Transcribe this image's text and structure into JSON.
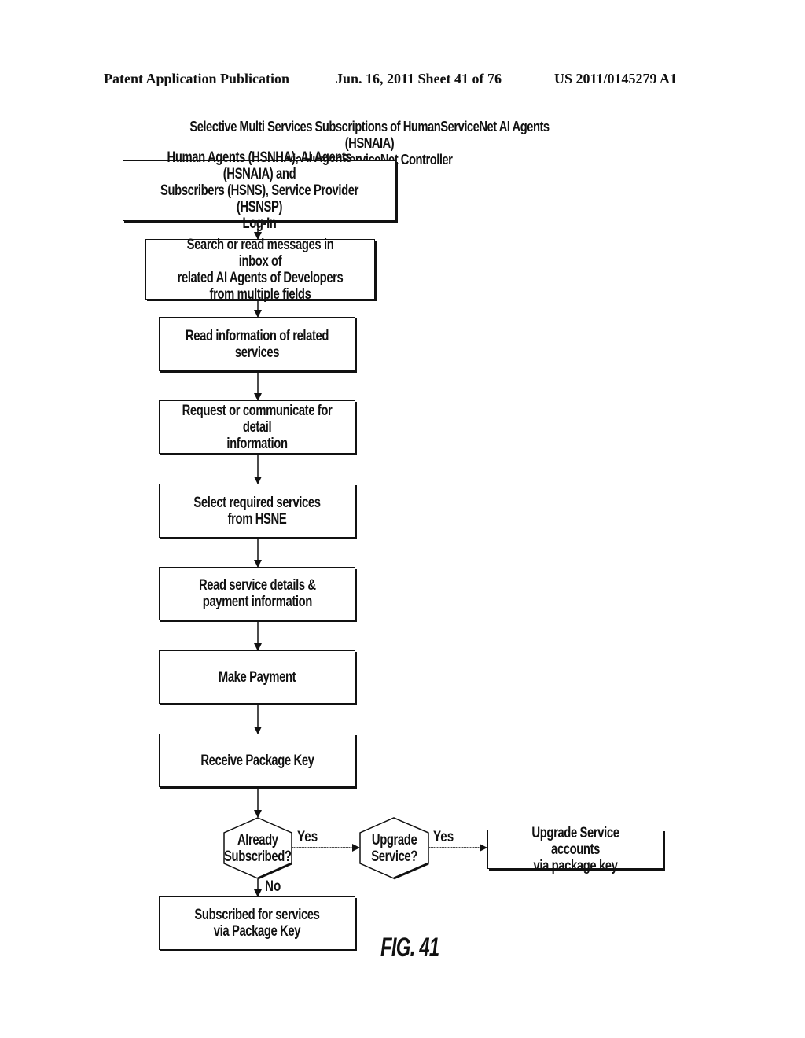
{
  "header": {
    "publication": "Patent Application Publication",
    "date_sheet": "Jun. 16, 2011  Sheet 41 of 76",
    "patent_number": "US 2011/0145279 A1"
  },
  "diagram": {
    "title": "Selective Multi Services Subscriptions of HumanServiceNet AI Agents (HSNAIA)\nvia HumanServiceNet Controller",
    "steps": [
      {
        "id": "login",
        "text": "Human Agents (HSNHA), AI Agents (HSNAIA) and\nSubscribers (HSNS), Service Provider (HSNSP)\nLog-In"
      },
      {
        "id": "search",
        "text": "Search or read messages in inbox of\nrelated AI Agents of Developers\nfrom multiple fields"
      },
      {
        "id": "read-info",
        "text": "Read information of related services"
      },
      {
        "id": "request",
        "text": "Request or communicate for detail\ninformation"
      },
      {
        "id": "select",
        "text": "Select required services from HSNE"
      },
      {
        "id": "read-details",
        "text": "Read service details &\npayment information"
      },
      {
        "id": "payment",
        "text": "Make Payment"
      },
      {
        "id": "receive-key",
        "text": "Receive Package Key"
      },
      {
        "id": "subscribed",
        "text": "Subscribed for services\nvia Package Key"
      },
      {
        "id": "upgrade-accounts",
        "text": "Upgrade Service accounts\nvia package key"
      }
    ],
    "decisions": [
      {
        "id": "already-subscribed",
        "text": "Already\nSubscribed?"
      },
      {
        "id": "upgrade-service",
        "text": "Upgrade\nService?"
      }
    ],
    "edge_labels": {
      "yes_1": "Yes",
      "yes_2": "Yes",
      "no": "No"
    },
    "figure_label": "FIG. 41"
  }
}
